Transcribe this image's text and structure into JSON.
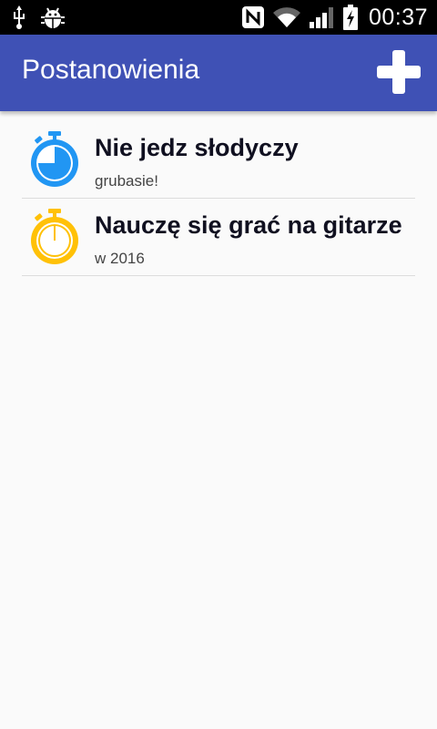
{
  "status_bar": {
    "time": "00:37",
    "icons": [
      "usb-icon",
      "android-debug-icon",
      "nfc-icon",
      "wifi-icon",
      "signal-icon",
      "battery-charging-icon"
    ]
  },
  "app_bar": {
    "title": "Postanowienia",
    "add_icon": "plus-icon",
    "color": "#3f51b5"
  },
  "resolutions": [
    {
      "title": "Nie jedz słodyczy",
      "subtitle": "grubasie!",
      "icon": "stopwatch-icon",
      "icon_color": "#2196f3",
      "progress": 0.75
    },
    {
      "title": "Nauczę się grać na gitarze",
      "subtitle": "w 2016",
      "icon": "stopwatch-icon",
      "icon_color": "#ffc107",
      "progress": 0
    }
  ]
}
